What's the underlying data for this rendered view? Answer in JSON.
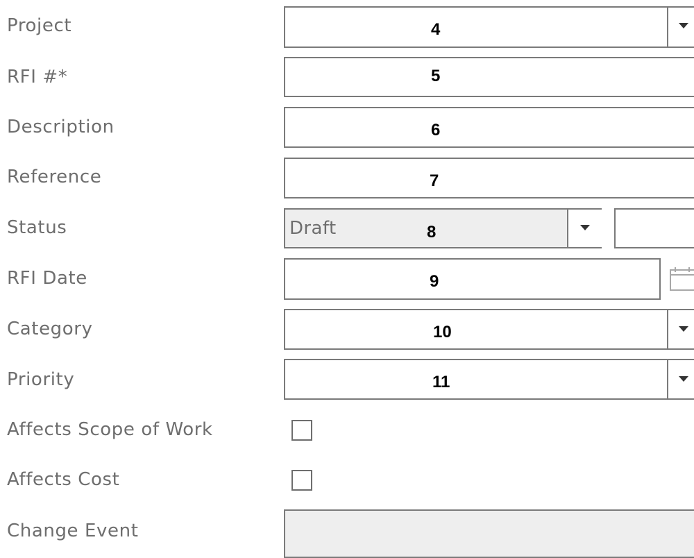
{
  "form": {
    "fields": [
      {
        "label": "Project",
        "marker": "4"
      },
      {
        "label": "RFI #*",
        "marker": "5"
      },
      {
        "label": "Description",
        "marker": "6"
      },
      {
        "label": "Reference",
        "marker": "7"
      },
      {
        "label": "Status",
        "marker": "8",
        "value": "Draft"
      },
      {
        "label": "RFI Date",
        "marker": "9"
      },
      {
        "label": "Category",
        "marker": "10"
      },
      {
        "label": "Priority",
        "marker": "11"
      },
      {
        "label": "Affects Scope of Work",
        "checked": false
      },
      {
        "label": "Affects Cost",
        "checked": false
      },
      {
        "label": "Change Event"
      }
    ]
  },
  "icons": {
    "dropdown": "caret-down-icon",
    "date": "calendar-icon"
  },
  "colors": {
    "border": "#7a7a7a",
    "label": "#6e6e6e",
    "disabled_fill": "#eeeeee",
    "marker": "#000000"
  }
}
